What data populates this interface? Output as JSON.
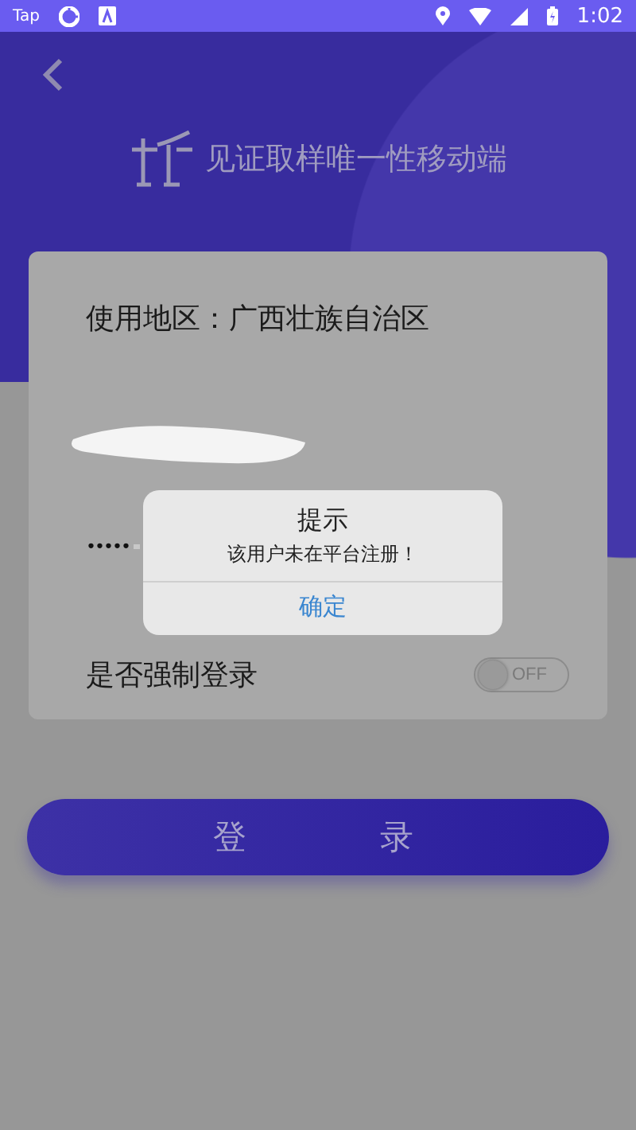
{
  "status_bar": {
    "app_label": "Tap",
    "time": "1:02"
  },
  "header": {
    "title": "见证取样唯一性移动端"
  },
  "form": {
    "region": "使用地区：广西壮族自治区",
    "password": {
      "value": "•••••"
    },
    "force_login": {
      "label": "是否强制登录",
      "on": false,
      "switch_text": "OFF"
    }
  },
  "login_button": {
    "label": "登录"
  },
  "dialog": {
    "title": "提示",
    "message": "该用户未在平台注册！",
    "button": "确定"
  }
}
